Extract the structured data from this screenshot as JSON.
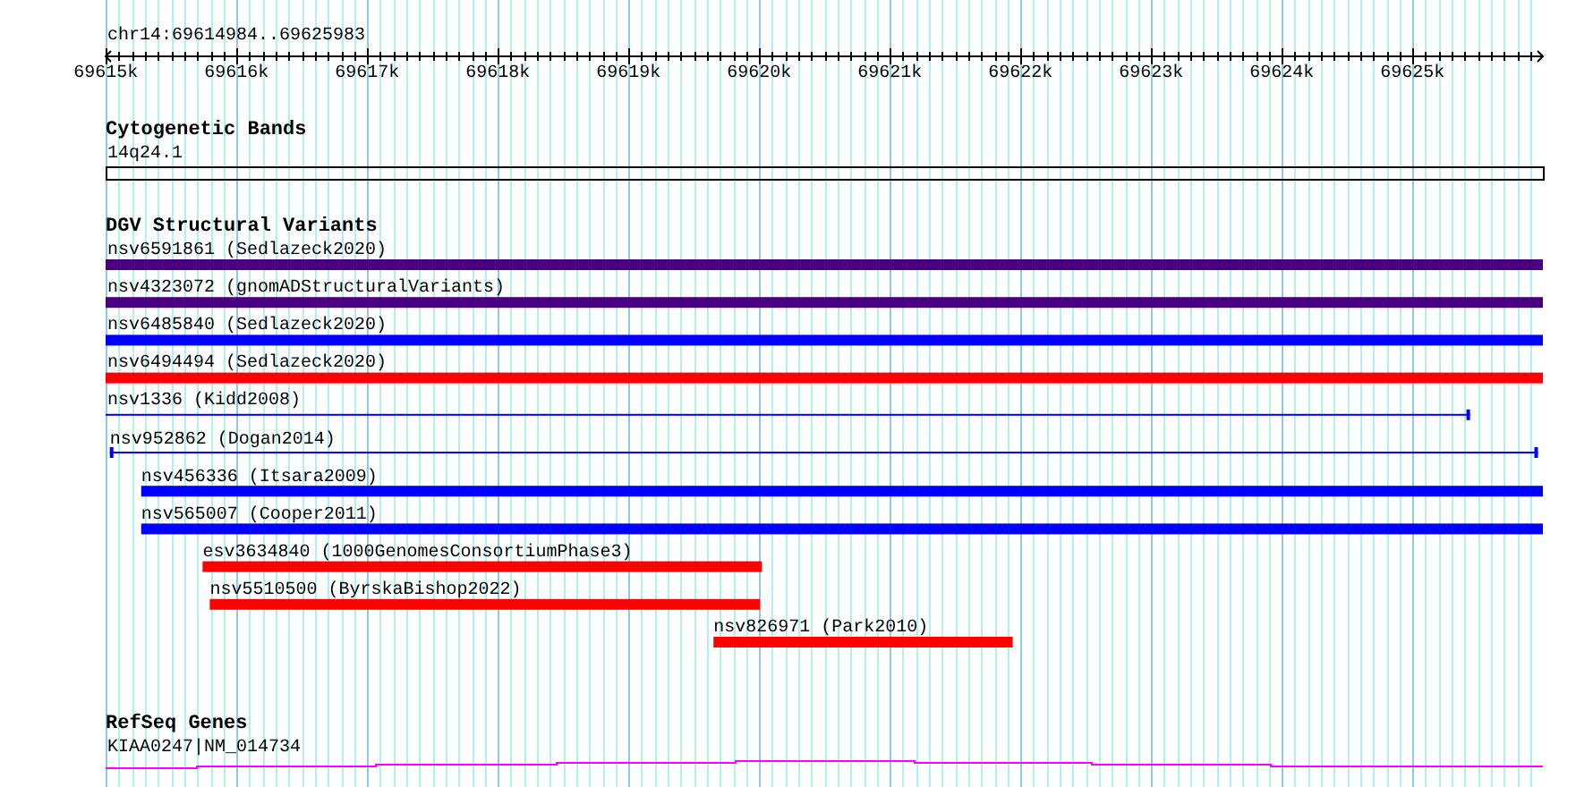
{
  "ruler": {
    "title": "chr14:69614984..69625983",
    "ticks": [
      "69615k",
      "69616k",
      "69617k",
      "69618k",
      "69619k",
      "69620k",
      "69621k",
      "69622k",
      "69623k",
      "69624k",
      "69625k"
    ]
  },
  "tracks": [
    {
      "kind": "bands",
      "title": "Cytogenetic Bands",
      "features": [
        {
          "label": "14q24.1"
        }
      ]
    },
    {
      "kind": "variants",
      "title": "DGV Structural Variants",
      "features": [
        {
          "label": "nsv6591861 (Sedlazeck2020)",
          "kind": "thick",
          "color": "#4b0082"
        },
        {
          "label": "nsv4323072 (gnomADStructuralVariants)",
          "kind": "thick",
          "color": "#4b0082"
        },
        {
          "label": "nsv6485840 (Sedlazeck2020)",
          "kind": "thick",
          "color": "#0000ff"
        },
        {
          "label": "nsv6494494 (Sedlazeck2020)",
          "kind": "thick",
          "color": "#ff0000"
        },
        {
          "label": "nsv1336 (Kidd2008)",
          "kind": "thin",
          "color": "#0000ff"
        },
        {
          "label": "nsv952862 (Dogan2014)",
          "kind": "thin",
          "color": "#0000ff"
        },
        {
          "label": "nsv456336 (Itsara2009)",
          "kind": "thick",
          "color": "#0000ff"
        },
        {
          "label": "nsv565007 (Cooper2011)",
          "kind": "thick",
          "color": "#0000ff"
        },
        {
          "label": "esv3634840 (1000GenomesConsortiumPhase3)",
          "kind": "thick",
          "color": "#ff0000"
        },
        {
          "label": "nsv5510500 (ByrskaBishop2022)",
          "kind": "thick",
          "color": "#ff0000"
        },
        {
          "label": "nsv826971 (Park2010)",
          "kind": "thick",
          "color": "#ff0000"
        }
      ]
    },
    {
      "kind": "genes",
      "title": "RefSeq Genes",
      "features": [
        {
          "label": "KIAA0247|NM_014734"
        }
      ]
    }
  ]
}
